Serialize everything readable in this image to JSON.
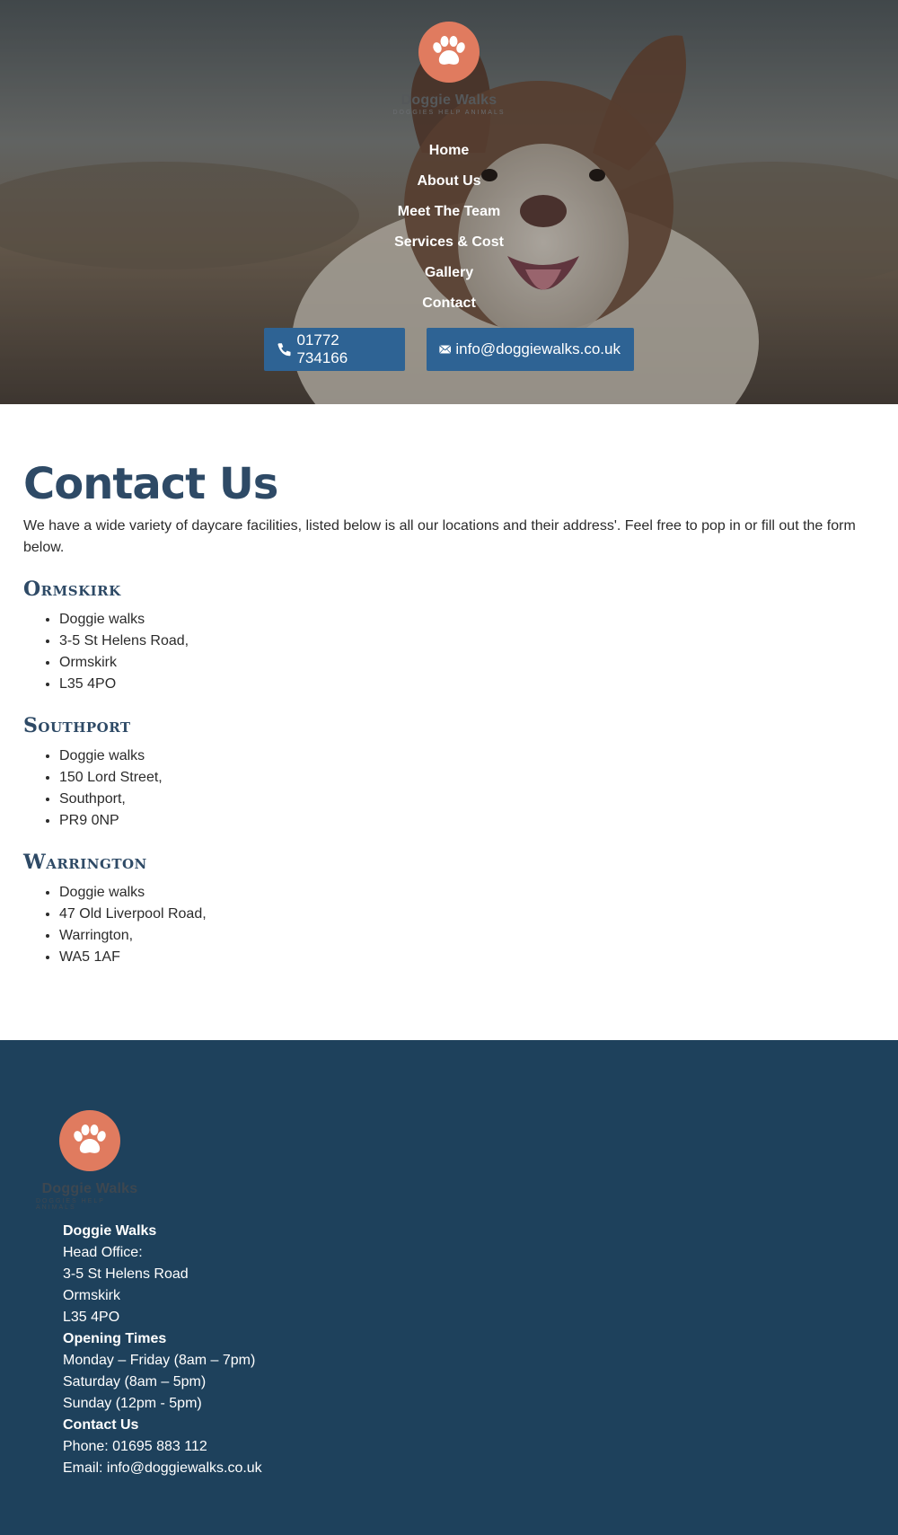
{
  "brand": {
    "name": "Doggie Walks",
    "tagline": "DOGGIES HELP ANIMALS",
    "accent": "#e07b5f",
    "heading_color": "#2e4a66",
    "button_color": "#2e6394",
    "footer_color": "#1e415c"
  },
  "nav": {
    "items": [
      "Home",
      "About Us",
      "Meet The Team",
      "Services & Cost",
      "Gallery",
      "Contact"
    ]
  },
  "header_contacts": {
    "phone": "01772 734166",
    "email": "info@doggiewalks.co.uk",
    "phone_icon": "phone-icon",
    "email_icon": "envelope-icon"
  },
  "main": {
    "title": "Contact Us",
    "intro": "We have a wide variety of daycare facilities, listed below is all our locations and their address'. Feel free to pop in or fill out the form below.",
    "locations": [
      {
        "name": "Ormskirk",
        "lines": [
          "Doggie walks",
          "3-5 St Helens Road,",
          "Ormskirk",
          "L35 4PO"
        ]
      },
      {
        "name": "Southport",
        "lines": [
          "Doggie walks",
          "150 Lord Street,",
          "Southport,",
          "PR9 0NP"
        ]
      },
      {
        "name": "Warrington",
        "lines": [
          "Doggie walks",
          "47 Old Liverpool Road,",
          "Warrington,",
          "WA5 1AF"
        ]
      }
    ]
  },
  "footer": {
    "company": "Doggie Walks",
    "head_office_label": "Head Office:",
    "address": [
      "3-5 St Helens Road",
      "Ormskirk",
      "L35 4PO"
    ],
    "opening_title": "Opening Times",
    "opening": [
      "Monday – Friday (8am – 7pm)",
      "Saturday (8am – 5pm)",
      "Sunday (12pm - 5pm)"
    ],
    "contact_title": "Contact Us",
    "phone": "Phone: 01695 883 112",
    "email": "Email: info@doggiewalks.co.uk"
  }
}
